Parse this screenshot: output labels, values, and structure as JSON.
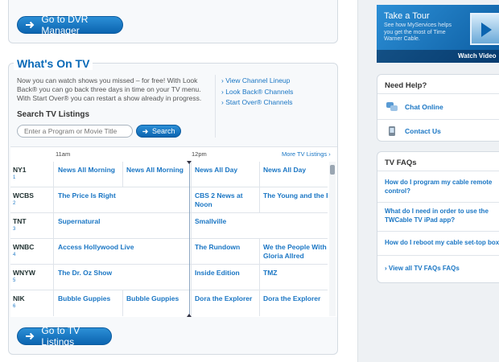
{
  "dvr": {
    "button_label": "Go to DVR Manager"
  },
  "whats_on": {
    "title": "What's On TV",
    "description": "Now you can watch shows you missed – for free! With Look Back® you can go back three days in time on your TV menu. With Start Over® you can restart a show already in progress.",
    "search_title": "Search TV Listings",
    "search_placeholder": "Enter a Program or Movie Title",
    "search_button": "Search",
    "links": [
      "View Channel Lineup",
      "Look Back® Channels",
      "Start Over® Channels"
    ],
    "times": [
      "11am",
      "12pm"
    ],
    "more_listings": "More TV Listings",
    "listings_button": "Go to TV Listings"
  },
  "grid": {
    "rows": [
      {
        "channel": "NY1",
        "number": "1",
        "programs": [
          "News All Morning",
          "News All Morning",
          "News All Day",
          "News All Day"
        ]
      },
      {
        "channel": "WCBS",
        "number": "2",
        "programs": [
          "The Price Is Right",
          "CBS 2 News at Noon",
          "The Young and the R"
        ]
      },
      {
        "channel": "TNT",
        "number": "3",
        "programs": [
          "Supernatural",
          "Smallville"
        ]
      },
      {
        "channel": "WNBC",
        "number": "4",
        "programs": [
          "Access Hollywood Live",
          "The Rundown",
          "We the People With Gloria Allred"
        ]
      },
      {
        "channel": "WNYW",
        "number": "5",
        "programs": [
          "The Dr. Oz Show",
          "Inside Edition",
          "TMZ"
        ]
      },
      {
        "channel": "NIK",
        "number": "6",
        "programs": [
          "Bubble Guppies",
          "Bubble Guppies",
          "Dora the Explorer",
          "Dora the Explorer"
        ]
      }
    ]
  },
  "tour": {
    "title": "Take a Tour",
    "subtitle": "See how MyServices helps you get the most of Time Warner Cable.",
    "watch": "Watch Video"
  },
  "help": {
    "title": "Need Help?",
    "items": [
      "Chat Online",
      "Contact Us"
    ]
  },
  "faqs": {
    "title": "TV FAQs",
    "items": [
      "How do I program my cable remote control?",
      "What do I need in order to use the TWCable TV iPad app?",
      "How do I reboot my cable set-top box?"
    ],
    "view_all": "View all TV FAQs FAQs"
  },
  "colors": {
    "accent": "#1a76c4",
    "button": "#0b64b0",
    "title": "#0a6ab8"
  }
}
